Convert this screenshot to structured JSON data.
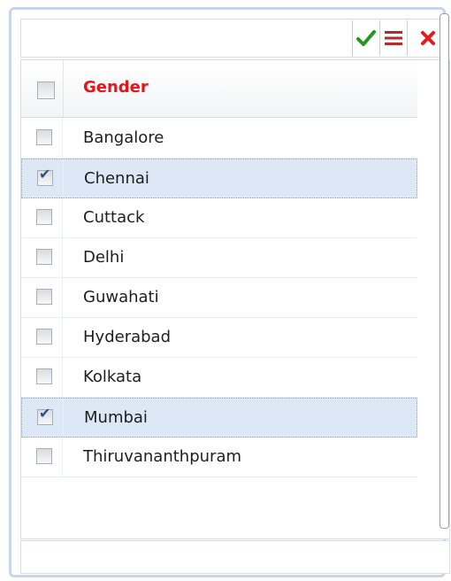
{
  "toolbar": {
    "confirm_icon": "checkmark-icon",
    "menu_icon": "menu-icon",
    "close_icon": "close-icon",
    "colors": {
      "confirm": "#1e9a1e",
      "menu": "#b52a2a",
      "close": "#e31b1b"
    }
  },
  "grid": {
    "header": {
      "label": "Gender",
      "checked": false
    },
    "rows": [
      {
        "label": "Bangalore",
        "checked": false
      },
      {
        "label": "Chennai",
        "checked": true
      },
      {
        "label": "Cuttack",
        "checked": false
      },
      {
        "label": "Delhi",
        "checked": false
      },
      {
        "label": "Guwahati",
        "checked": false
      },
      {
        "label": "Hyderabad",
        "checked": false
      },
      {
        "label": "Kolkata",
        "checked": false
      },
      {
        "label": "Mumbai",
        "checked": true
      },
      {
        "label": "Thiruvananthpuram",
        "checked": false
      }
    ]
  },
  "colors": {
    "header_text": "#e8141a",
    "selected_row": "#dde8f7",
    "panel_border": "#c7d6ec"
  }
}
